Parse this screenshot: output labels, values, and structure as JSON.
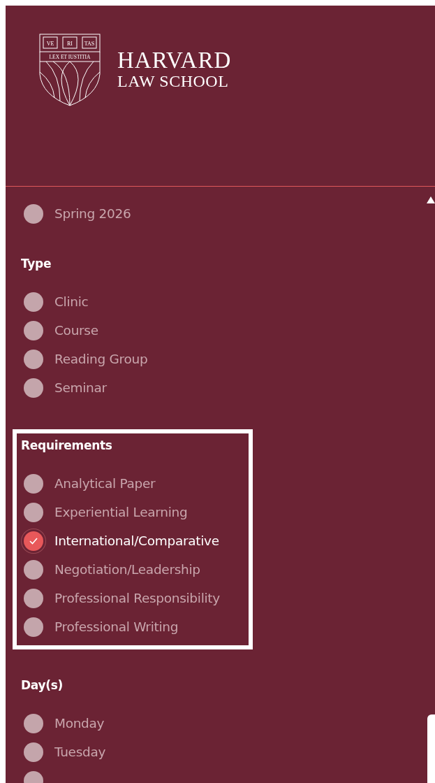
{
  "header": {
    "logo": {
      "shield_top": [
        "VE",
        "RI",
        "TAS"
      ],
      "motto": "LEX ET IUSTITIA"
    },
    "wordmark": [
      "HARVARD",
      "LAW SCHOOL"
    ]
  },
  "sections": [
    {
      "options": [
        {
          "label": "Spring 2026",
          "checked": false
        }
      ]
    },
    {
      "heading": "Type",
      "highlighted": false,
      "options": [
        {
          "label": "Clinic",
          "checked": false
        },
        {
          "label": "Course",
          "checked": false
        },
        {
          "label": "Reading Group",
          "checked": false
        },
        {
          "label": "Seminar",
          "checked": false
        }
      ]
    },
    {
      "heading": "Requirements",
      "highlighted": true,
      "options": [
        {
          "label": "Analytical Paper",
          "checked": false
        },
        {
          "label": "Experiential Learning",
          "checked": false
        },
        {
          "label": "International/Comparative",
          "checked": true
        },
        {
          "label": "Negotiation/Leadership",
          "checked": false
        },
        {
          "label": "Professional Responsibility",
          "checked": false
        },
        {
          "label": "Professional Writing",
          "checked": false
        }
      ]
    },
    {
      "heading": "Day(s)",
      "highlighted": false,
      "options": [
        {
          "label": "Monday",
          "checked": false
        },
        {
          "label": "Tuesday",
          "checked": false
        },
        {
          "checked": false
        }
      ]
    }
  ]
}
